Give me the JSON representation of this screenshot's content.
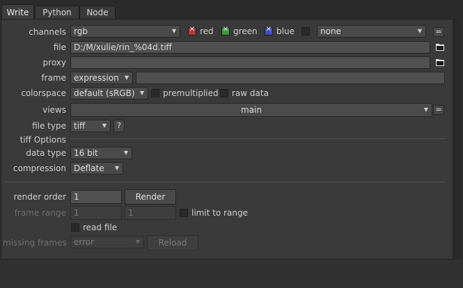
{
  "tabs": [
    {
      "label": "Write"
    },
    {
      "label": "Python"
    },
    {
      "label": "Node"
    }
  ],
  "fields": {
    "channels": {
      "label": "channels",
      "value": "rgb",
      "extra_value": "none",
      "red_label": "red",
      "green_label": "green",
      "blue_label": "blue"
    },
    "file": {
      "label": "file",
      "value": "D:/M/xulie/rin_%04d.tiff"
    },
    "proxy": {
      "label": "proxy",
      "value": ""
    },
    "frame": {
      "label": "frame",
      "mode": "expression",
      "value": ""
    },
    "colorspace": {
      "label": "colorspace",
      "value": "default (sRGB)",
      "premultiplied_label": "premultiplied",
      "raw_label": "raw data"
    },
    "views": {
      "label": "views",
      "value": "main"
    },
    "file_type": {
      "label": "file type",
      "value": "tiff",
      "help": "?"
    },
    "tiff_options": {
      "label": "tiff Options"
    },
    "data_type": {
      "label": "data type",
      "value": "16 bit"
    },
    "compression": {
      "label": "compression",
      "value": "Deflate"
    },
    "render_order": {
      "label": "render order",
      "value": "1",
      "button": "Render"
    },
    "frame_range": {
      "label": "frame range",
      "start": "1",
      "end": "1",
      "limit_label": "limit to range"
    },
    "read_file": {
      "label": "read file"
    },
    "missing_frames": {
      "label": "missing frames",
      "value": "error",
      "button": "Reload"
    }
  },
  "icons": {
    "eq_symbol": "="
  },
  "colors": {
    "red": "#b33a3a",
    "green": "#3b9a3b",
    "blue": "#3f4fbf"
  }
}
